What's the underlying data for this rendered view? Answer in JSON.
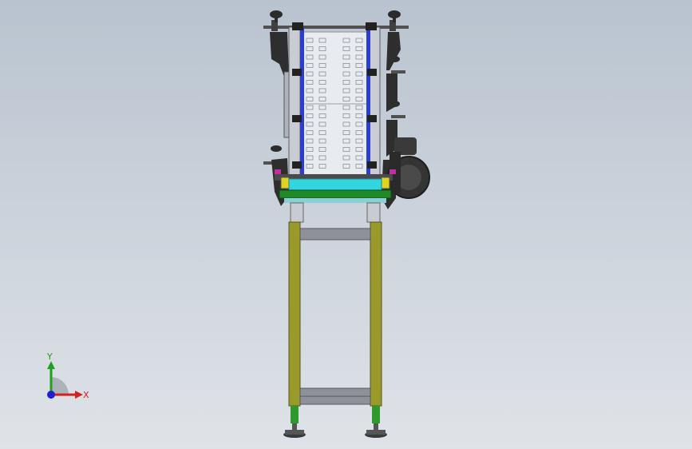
{
  "viewport": {
    "background_top": "#b9c3cf",
    "background_bottom": "#dfe3e8"
  },
  "model": {
    "parts": [
      "conveyor-frame",
      "conveyor-belt",
      "side-guide-rails",
      "adjustment-knobs",
      "drive-motor",
      "support-legs",
      "cross-braces",
      "leveling-feet"
    ],
    "colors": {
      "legs": "#9a9a2a",
      "guide_rails": "#2a3fd0",
      "belt_edge": "#33d6e0",
      "base_plate": "#1f8a2a",
      "frame": "#3a3a3a",
      "feet": "#2e9a2e"
    }
  },
  "triad": {
    "x_label": "X",
    "y_label": "Y",
    "x_color": "#d42020",
    "y_color": "#20a020",
    "z_color": "#2020d0"
  }
}
